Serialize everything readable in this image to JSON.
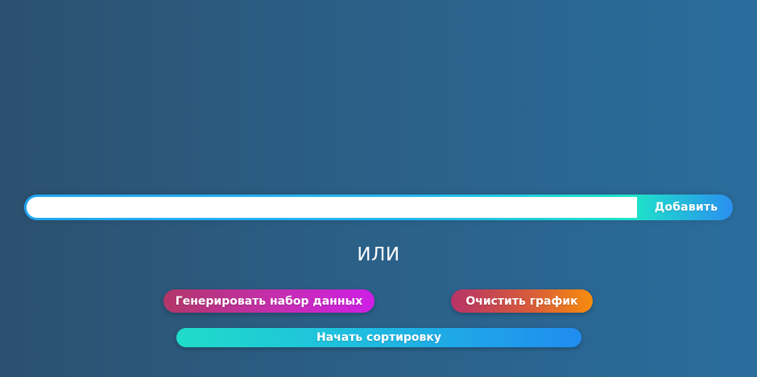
{
  "input": {
    "value": "",
    "placeholder": ""
  },
  "buttons": {
    "add_label": "Добавить",
    "generate_label": "Генерировать набор данных",
    "clear_label": "Очистить график",
    "sort_label": "Начать сортировку"
  },
  "divider": {
    "or_label": "ИЛИ"
  }
}
